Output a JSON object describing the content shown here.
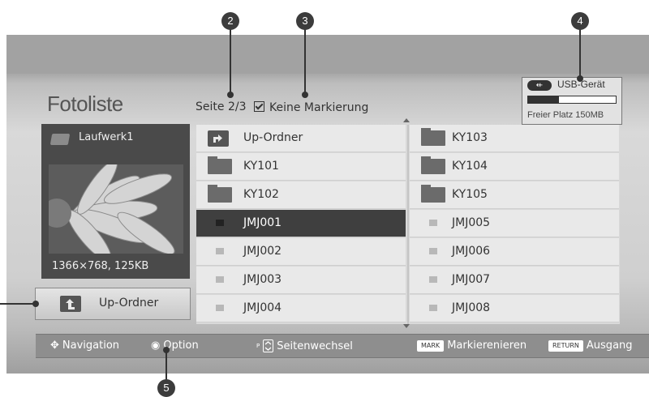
{
  "screen": {
    "title": "Fotoliste",
    "page_indicator": "Seite 2/3",
    "mark_status": "Keine Markierung"
  },
  "usb": {
    "label": "USB-Gerät",
    "free_space": "Freier Platz 150MB",
    "usage_fraction": 0.35
  },
  "preview": {
    "drive_label": "Laufwerk1",
    "image_info": "1366×768, 125KB"
  },
  "up_folder_button": {
    "label": "Up-Ordner"
  },
  "file_list": {
    "left_column": [
      {
        "name": "Up-Ordner",
        "type": "up-folder"
      },
      {
        "name": "KY101",
        "type": "folder"
      },
      {
        "name": "KY102",
        "type": "folder"
      },
      {
        "name": "JMJ001",
        "type": "photo",
        "selected": true
      },
      {
        "name": "JMJ002",
        "type": "photo"
      },
      {
        "name": "JMJ003",
        "type": "photo"
      },
      {
        "name": "JMJ004",
        "type": "photo"
      }
    ],
    "right_column": [
      {
        "name": "KY103",
        "type": "folder"
      },
      {
        "name": "KY104",
        "type": "folder"
      },
      {
        "name": "KY105",
        "type": "folder"
      },
      {
        "name": "JMJ005",
        "type": "photo"
      },
      {
        "name": "JMJ006",
        "type": "photo"
      },
      {
        "name": "JMJ007",
        "type": "photo"
      },
      {
        "name": "JMJ008",
        "type": "photo"
      }
    ]
  },
  "help_bar": {
    "navigation": "Navigation",
    "option": "Option",
    "page_key": "P",
    "page_change": "Seitenwechsel",
    "mark_key": "MARK",
    "mark_label": "Markierenieren",
    "return_key": "RETURN",
    "return_label": "Ausgang"
  },
  "callouts": {
    "c2": "2",
    "c3": "3",
    "c4": "4",
    "c5": "5"
  },
  "colors": {
    "selected_row": "#3f3f3f",
    "callout": "#3c3c3c"
  }
}
